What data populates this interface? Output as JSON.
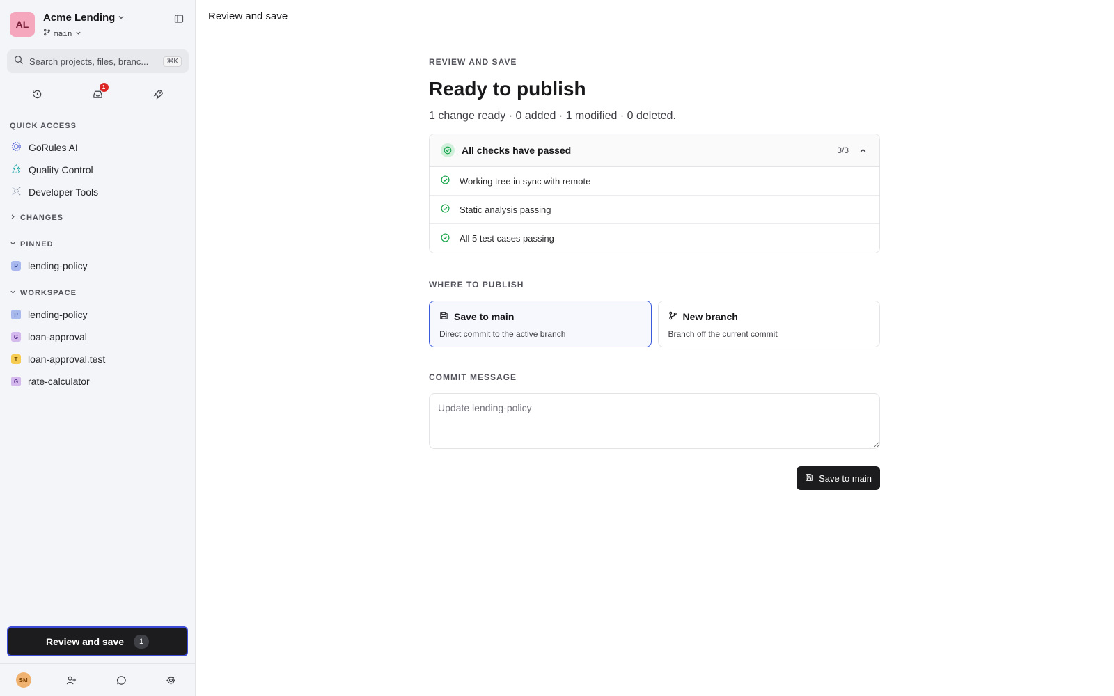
{
  "workspace": {
    "initials": "AL",
    "name": "Acme Lending",
    "branch": "main"
  },
  "search": {
    "placeholder": "Search projects, files, branc...",
    "shortcut": "⌘K"
  },
  "toolbar_icons": {
    "notifications_count": "1"
  },
  "quick_access": {
    "title": "QUICK ACCESS",
    "items": [
      {
        "label": "GoRules AI",
        "icon": "sparkle-gear-icon"
      },
      {
        "label": "Quality Control",
        "icon": "tree-icon"
      },
      {
        "label": "Developer Tools",
        "icon": "bug-icon"
      }
    ]
  },
  "changes": {
    "title": "CHANGES"
  },
  "pinned": {
    "title": "PINNED",
    "items": [
      {
        "label": "lending-policy",
        "badge": "P"
      }
    ]
  },
  "workspace_files": {
    "title": "WORKSPACE",
    "items": [
      {
        "label": "lending-policy",
        "badge": "P"
      },
      {
        "label": "loan-approval",
        "badge": "G"
      },
      {
        "label": "loan-approval.test",
        "badge": "T"
      },
      {
        "label": "rate-calculator",
        "badge": "G"
      }
    ]
  },
  "review_button": {
    "label": "Review and save",
    "count": "1"
  },
  "footer": {
    "user_initials": "SM"
  },
  "main": {
    "page_title": "Review and save",
    "eyebrow": "REVIEW AND SAVE",
    "headline": "Ready to publish",
    "summary": "1 change ready · 0 added · 1 modified · 0 deleted.",
    "checks": {
      "title": "All checks have passed",
      "count": "3/3",
      "items": [
        "Working tree in sync with remote",
        "Static analysis passing",
        "All 5 test cases passing"
      ]
    },
    "publish": {
      "label": "WHERE TO PUBLISH",
      "options": [
        {
          "title": "Save to main",
          "desc": "Direct commit to the active branch",
          "selected": true
        },
        {
          "title": "New branch",
          "desc": "Branch off the current commit",
          "selected": false
        }
      ]
    },
    "commit": {
      "label": "COMMIT MESSAGE",
      "placeholder": "Update lending-policy",
      "value": ""
    },
    "submit_label": "Save to main"
  },
  "colors": {
    "accent": "#3b5bdb",
    "success": "#16a34a",
    "danger": "#dc2626",
    "dark": "#1c1c1e"
  }
}
